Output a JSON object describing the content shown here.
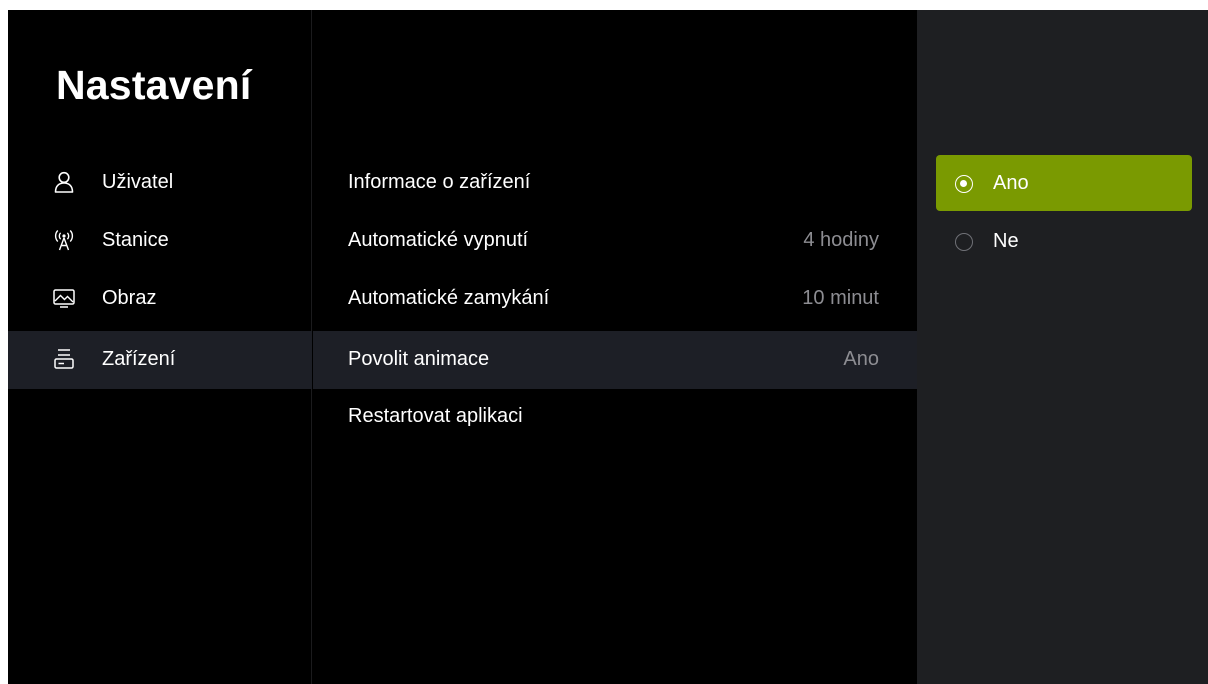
{
  "title": "Nastavení",
  "left_menu": {
    "items": [
      {
        "label": "Uživatel",
        "icon": "user-icon",
        "selected": false
      },
      {
        "label": "Stanice",
        "icon": "antenna-icon",
        "selected": false
      },
      {
        "label": "Obraz",
        "icon": "monitor-image-icon",
        "selected": false
      },
      {
        "label": "Zařízení",
        "icon": "router-icon",
        "selected": true
      }
    ]
  },
  "settings_list": {
    "items": [
      {
        "label": "Informace o zařízení",
        "value": ""
      },
      {
        "label": "Automatické vypnutí",
        "value": "4 hodiny"
      },
      {
        "label": "Automatické zamykání",
        "value": "10 minut"
      },
      {
        "label": "Povolit animace",
        "value": "Ano"
      },
      {
        "label": "Restartovat aplikaci",
        "value": ""
      }
    ],
    "selected_index": 3
  },
  "options": {
    "items": [
      {
        "label": "Ano",
        "selected": true
      },
      {
        "label": "Ne",
        "selected": false
      }
    ]
  },
  "colors": {
    "background": "#000000",
    "highlight_row": "#1d1f26",
    "accent": "#7a9a01",
    "options_panel": "#1e1f22",
    "secondary_text": "#8d8d92"
  }
}
